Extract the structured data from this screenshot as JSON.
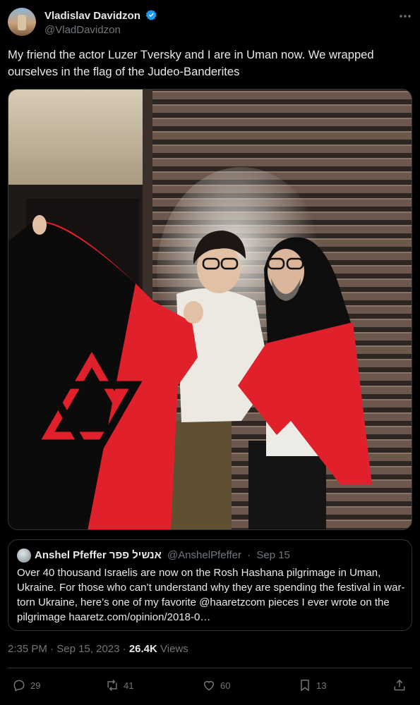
{
  "author": {
    "name": "Vladislav Davidzon",
    "handle": "@VladDavidzon"
  },
  "tweet": {
    "text": "My friend the actor Luzer Tversky and I are in Uman now. We wrapped ourselves in the flag of the Judeo-Banderites"
  },
  "quoted": {
    "name": "Anshel Pfeffer אנשיל פפר",
    "handle": "@AnshelPfeffer",
    "date": "Sep 15",
    "text": "Over 40 thousand Israelis are now on the Rosh Hashana pilgrimage in Uman, Ukraine. For those who can’t understand why they are spending the festival in war-torn Ukraine, here’s one of my favorite @haaretzcom pieces I ever wrote on the pilgrimage haaretz.com/opinion/2018-0…"
  },
  "meta": {
    "time": "2:35 PM",
    "date": "Sep 15, 2023",
    "views_count": "26.4K",
    "views_label": "Views"
  },
  "actions": {
    "replies": "29",
    "reposts": "41",
    "likes": "60",
    "bookmarks": "13"
  },
  "colors": {
    "background": "#000000",
    "text": "#e7e9ea",
    "secondary": "#71767b",
    "verified": "#1d9bf0",
    "flag_red": "#e0202a",
    "flag_black": "#0b0b0b"
  }
}
